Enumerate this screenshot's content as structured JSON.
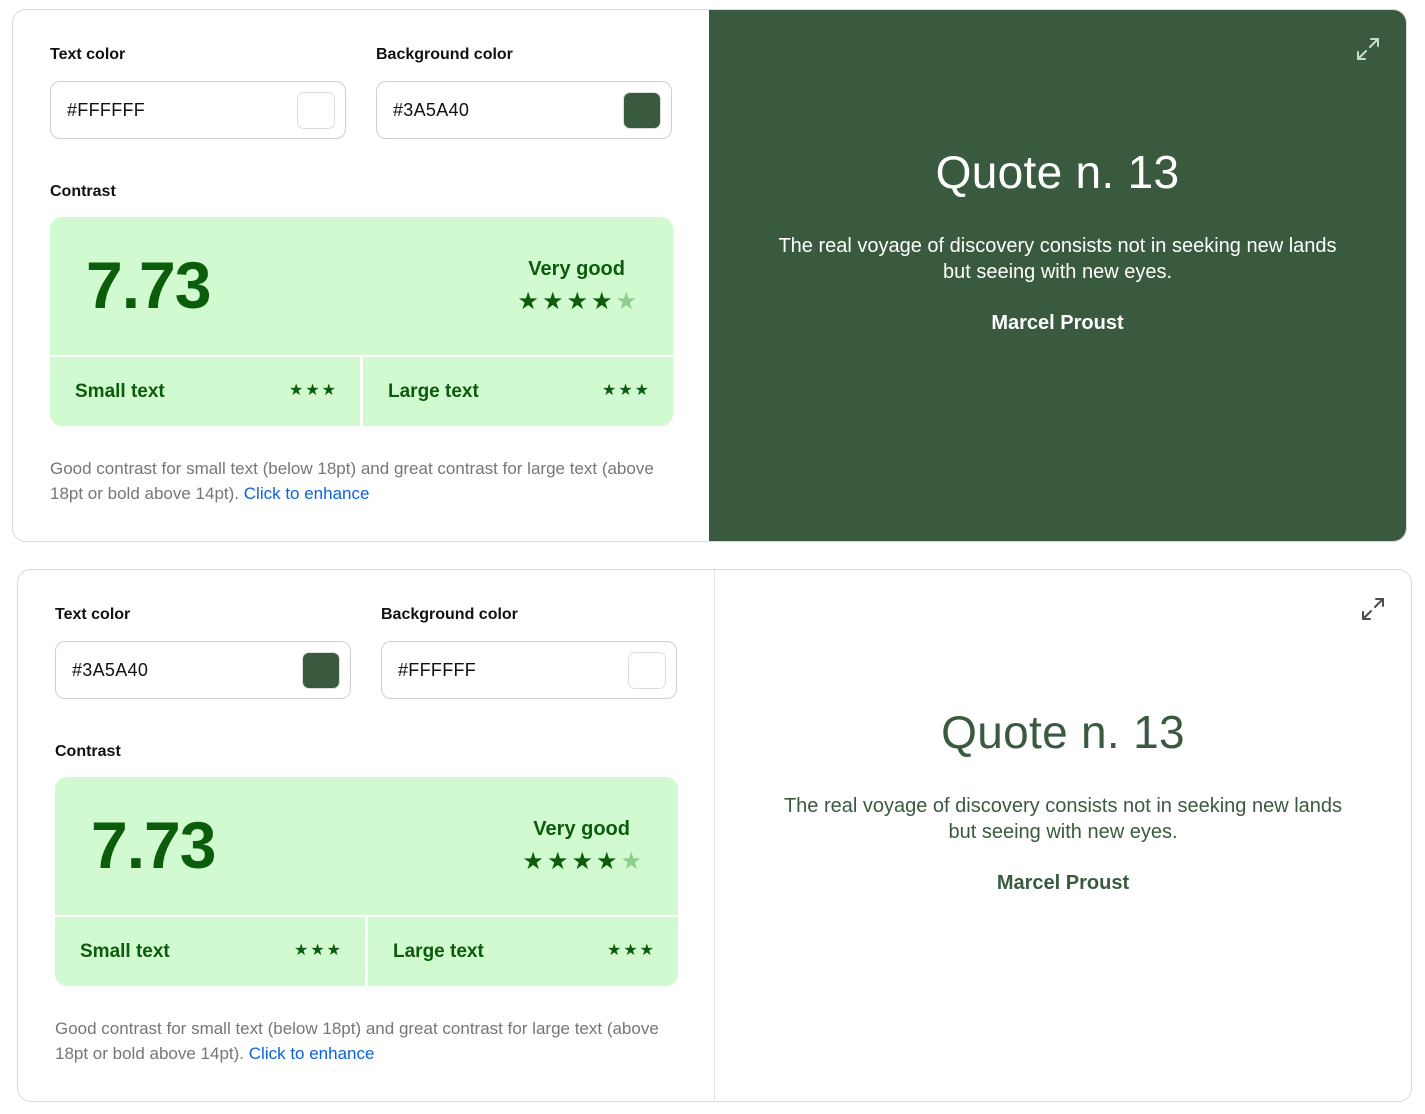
{
  "cards": [
    {
      "text_color_label": "Text color",
      "text_color_value": "#FFFFFF",
      "background_color_label": "Background color",
      "background_color_value": "#3A5A40",
      "contrast_label": "Contrast",
      "ratio": "7.73",
      "rating": "Very good",
      "rating_stars": 4,
      "rating_stars_max": 5,
      "small_text_label": "Small text",
      "small_text_stars": 3,
      "large_text_label": "Large text",
      "large_text_stars": 3,
      "description": "Good contrast for small text (below 18pt) and great contrast for large text (above 18pt or bold above 14pt).",
      "enhance_link": "Click to enhance",
      "expand_icon": "expand-icon",
      "preview": {
        "title": "Quote n. 13",
        "quote": "The real voyage of discovery consists not in seeking new lands but seeing with new eyes.",
        "author": "Marcel Proust",
        "background": "#3A5A40",
        "text_color": "#FFFFFF"
      }
    },
    {
      "text_color_label": "Text color",
      "text_color_value": "#3A5A40",
      "background_color_label": "Background color",
      "background_color_value": "#FFFFFF",
      "contrast_label": "Contrast",
      "ratio": "7.73",
      "rating": "Very good",
      "rating_stars": 4,
      "rating_stars_max": 5,
      "small_text_label": "Small text",
      "small_text_stars": 3,
      "large_text_label": "Large text",
      "large_text_stars": 3,
      "description": "Good contrast for small text (below 18pt) and great contrast for large text (above 18pt or bold above 14pt).",
      "enhance_link": "Click to enhance",
      "expand_icon": "expand-icon",
      "preview": {
        "title": "Quote n. 13",
        "quote": "The real voyage of discovery consists not in seeking new lands but seeing with new eyes.",
        "author": "Marcel Proust",
        "background": "#FFFFFF",
        "text_color": "#3A5A40"
      }
    }
  ],
  "colors": {
    "accent_green": "#0B5C0B",
    "contrast_bg": "#D2FAD0",
    "link": "#0B63D9",
    "muted_text": "#767676"
  }
}
